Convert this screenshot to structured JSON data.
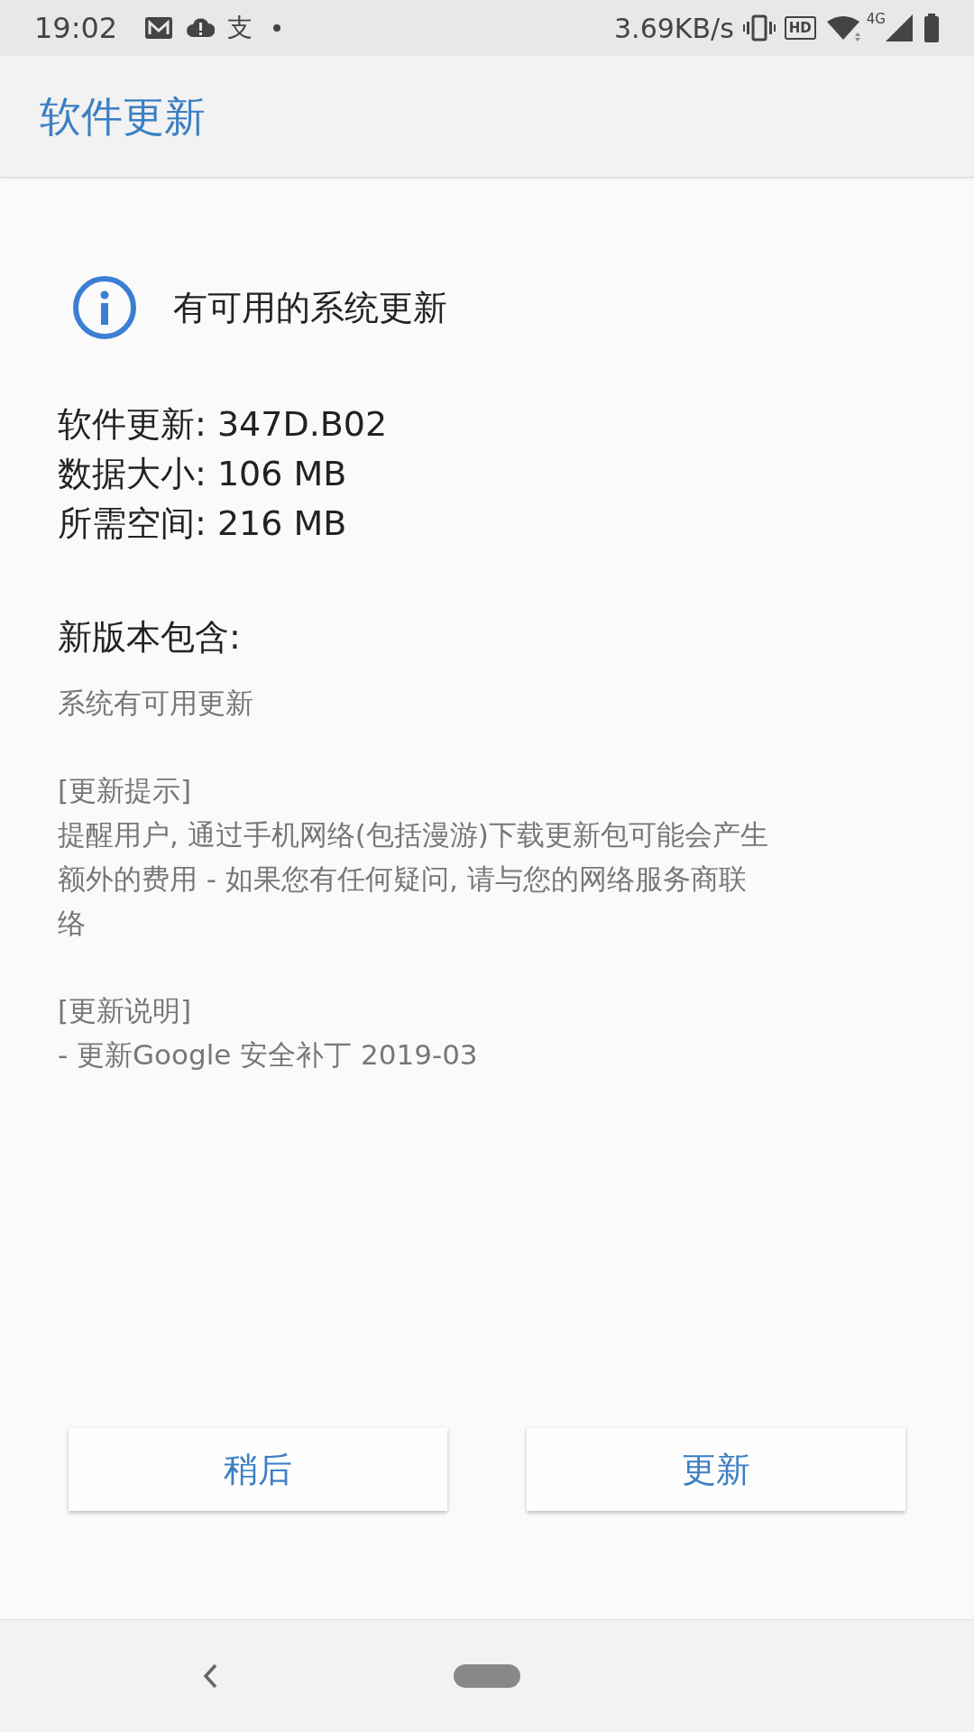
{
  "status_bar": {
    "time": "19:02",
    "notification_glyph": "支",
    "speed": "3.69KB/s",
    "hd": "HD",
    "network": "4G"
  },
  "app_bar": {
    "title": "软件更新"
  },
  "notice": {
    "text": "有可用的系统更新"
  },
  "details": [
    "软件更新: 347D.B02",
    "数据大小: 106 MB",
    "所需空间: 216 MB"
  ],
  "contents_heading": "新版本包含:",
  "notes": [
    {
      "kind": "text",
      "lines": [
        "系统有可用更新"
      ]
    },
    {
      "kind": "heading",
      "lines": [
        "[更新提示]"
      ]
    },
    {
      "kind": "text",
      "lines": [
        "提醒用户, 通过手机网络(包括漫游)下载更新包可能会产生",
        "额外的费用 - 如果您有任何疑问, 请与您的网络服务商联",
        "络"
      ]
    },
    {
      "kind": "heading",
      "lines": [
        "[更新说明]"
      ]
    },
    {
      "kind": "text",
      "lines": [
        "- 更新Google 安全补丁 2019-03"
      ]
    }
  ],
  "buttons": [
    "稍后",
    "更新"
  ]
}
